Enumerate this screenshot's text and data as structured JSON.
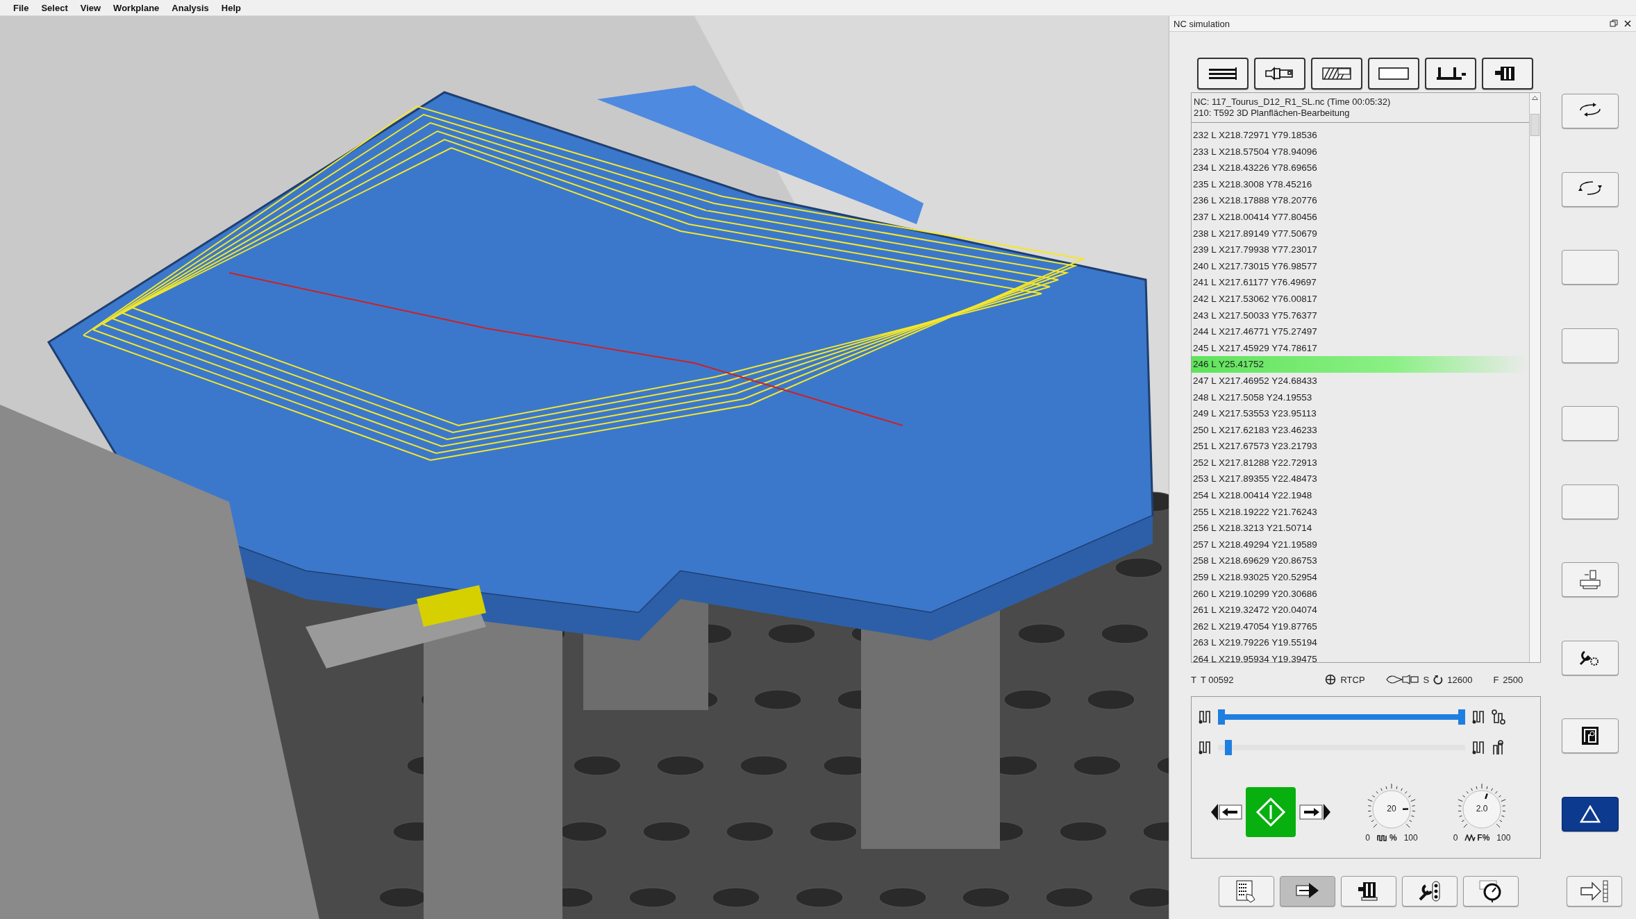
{
  "menu": [
    {
      "label": "File"
    },
    {
      "label": "Select"
    },
    {
      "label": "View"
    },
    {
      "label": "Workplane"
    },
    {
      "label": "Analysis"
    },
    {
      "label": "Help"
    }
  ],
  "panel": {
    "title": "NC simulation",
    "header": [
      "NC: 117_Tourus_D12_R1_SL.nc (Time 00:05:32)",
      "210: T592 3D Planflächen-Bearbeitung"
    ],
    "rows": [
      {
        "text": "232 L X218.72971 Y79.18536",
        "selected": false
      },
      {
        "text": "233 L X218.57504 Y78.94096",
        "selected": false
      },
      {
        "text": "234 L X218.43226 Y78.69656",
        "selected": false
      },
      {
        "text": "235 L X218.3008 Y78.45216",
        "selected": false
      },
      {
        "text": "236 L X218.17888 Y78.20776",
        "selected": false
      },
      {
        "text": "237 L X218.00414 Y77.80456",
        "selected": false
      },
      {
        "text": "238 L X217.89149 Y77.50679",
        "selected": false
      },
      {
        "text": "239 L X217.79938 Y77.23017",
        "selected": false
      },
      {
        "text": "240 L X217.73015 Y76.98577",
        "selected": false
      },
      {
        "text": "241 L X217.61177 Y76.49697",
        "selected": false
      },
      {
        "text": "242 L X217.53062 Y76.00817",
        "selected": false
      },
      {
        "text": "243 L X217.50033 Y75.76377",
        "selected": false
      },
      {
        "text": "244 L X217.46771 Y75.27497",
        "selected": false
      },
      {
        "text": "245 L X217.45929 Y74.78617",
        "selected": false
      },
      {
        "text": "246 L Y25.41752",
        "selected": true
      },
      {
        "text": "247 L X217.46952 Y24.68433",
        "selected": false
      },
      {
        "text": "248 L X217.5058 Y24.19553",
        "selected": false
      },
      {
        "text": "249 L X217.53553 Y23.95113",
        "selected": false
      },
      {
        "text": "250 L X217.62183 Y23.46233",
        "selected": false
      },
      {
        "text": "251 L X217.67573 Y23.21793",
        "selected": false
      },
      {
        "text": "252 L X217.81288 Y22.72913",
        "selected": false
      },
      {
        "text": "253 L X217.89355 Y22.48473",
        "selected": false
      },
      {
        "text": "254 L X218.00414 Y22.1948",
        "selected": false
      },
      {
        "text": "255 L X218.19222 Y21.76243",
        "selected": false
      },
      {
        "text": "256 L X218.3213 Y21.50714",
        "selected": false
      },
      {
        "text": "257 L X218.49294 Y21.19589",
        "selected": false
      },
      {
        "text": "258 L X218.69629 Y20.86753",
        "selected": false
      },
      {
        "text": "259 L X218.93025 Y20.52954",
        "selected": false
      },
      {
        "text": "260 L X219.10299 Y20.30686",
        "selected": false
      },
      {
        "text": "261 L X219.32472 Y20.04074",
        "selected": false
      },
      {
        "text": "262 L X219.47054 Y19.87765",
        "selected": false
      },
      {
        "text": "263 L X219.79226 Y19.55194",
        "selected": false
      },
      {
        "text": "264 L X219.95934 Y19.39475",
        "selected": false
      }
    ],
    "status": {
      "t_label": "T",
      "tool": "T 00592",
      "rtcp": "RTCP",
      "s_label": "S",
      "speed": "12600",
      "f_label": "F",
      "feed": "2500"
    },
    "sliders": [
      {
        "level": 1
      },
      {
        "level": 0.03
      }
    ],
    "dials": [
      {
        "value": "20",
        "min": "0",
        "label": "%",
        "max": "100",
        "level": 0.83
      },
      {
        "value": "2.0",
        "min": "0",
        "label": "F%",
        "max": "100",
        "level": 0.57
      }
    ],
    "bottom_toolbar": [
      {
        "selected": false
      },
      {
        "selected": true
      },
      {
        "selected": false
      },
      {
        "selected": false
      },
      {
        "selected": false
      }
    ]
  }
}
